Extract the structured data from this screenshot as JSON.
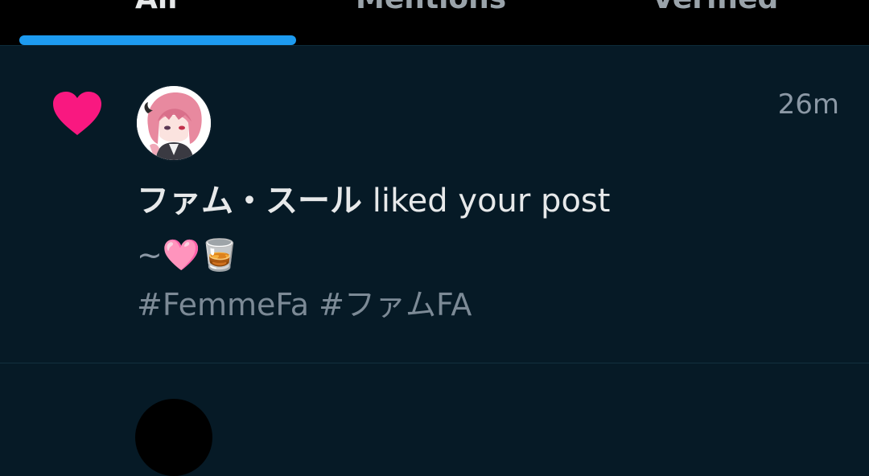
{
  "tabs": [
    {
      "label": "All",
      "active": true
    },
    {
      "label": "Mentions",
      "active": false
    },
    {
      "label": "Verified",
      "active": false
    }
  ],
  "notification": {
    "type_icon": "heart-icon",
    "user_name": "ファム・スール",
    "action": " liked your post",
    "timestamp": "26m",
    "post_text": "~🩷🥃",
    "hashtags": "#FemmeFa #ファムFA"
  },
  "colors": {
    "background": "#061a26",
    "tab_indicator": "#1d9bf0",
    "heart": "#f91880",
    "secondary_text": "#8b98a5"
  }
}
